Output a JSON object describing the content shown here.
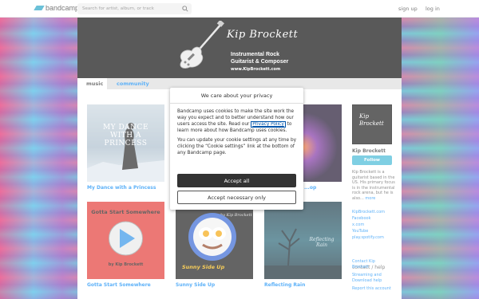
{
  "header": {
    "logo_text": "bandcamp",
    "search_placeholder": "Search for artist, album, or track",
    "signup_label": "sign up",
    "login_label": "log in"
  },
  "banner": {
    "artist_name": "Kip Brockett",
    "subtitle_line1": "Instrumental Rock",
    "subtitle_line2": "Guitarist & Composer",
    "url": "www.KipBrockett.com"
  },
  "tabs": [
    {
      "label": "music"
    },
    {
      "label": "community"
    }
  ],
  "albums": [
    {
      "title": "My Dance with a Princess",
      "cover_text": "MY DANCE WITH A PRINCESS"
    },
    {
      "title": "",
      "cover_text": ""
    },
    {
      "title": "...op",
      "cover_text": ""
    },
    {
      "title": "Gotta Start Somewhere",
      "cover_text_top": "Gotta Start Somewhere",
      "cover_text_bottom": "by Kip Brockett"
    },
    {
      "title": "Sunny Side Up",
      "cover_text_top": "by Kip Brockett",
      "cover_text_bottom": "Sunny Side Up"
    },
    {
      "title": "Reflecting Rain",
      "cover_text": "Reflecting Rain"
    }
  ],
  "sidebar": {
    "thumb_text_line1": "Kip",
    "thumb_text_line2": "Brockett",
    "artist_name": "Kip Brockett",
    "follow_label": "Follow",
    "bio": "Kip Brockett is a guitarist based in the US. His primary focus is in the instrumental rock arena, but he is also...",
    "more_label": "more",
    "links": [
      "KipBrockett.com",
      "Facebook",
      "x.com",
      "YouTube",
      "play.spotify.com"
    ],
    "contact_heading": "contact / help",
    "contact_links": [
      "Contact Kip Brockett",
      "Streaming and Download help",
      "Report this account"
    ]
  },
  "cookie_modal": {
    "title": "We care about your privacy",
    "para1_before": "Bandcamp uses cookies to make the site work the way you expect and to better understand how our users access the site. Read our",
    "privacy_link": "Privacy Policy",
    "para1_after": "to learn more about how Bandcamp uses cookies.",
    "para2": "You can update your cookie settings at any time by clicking the “Cookie settings” link at the bottom of any Bandcamp page.",
    "accept_all_label": "Accept all",
    "accept_necessary_label": "Accept necessary only"
  },
  "colors": {
    "link_blue": "#0687f5",
    "follow_button": "#3bb6d4",
    "accept_button": "#333333"
  }
}
